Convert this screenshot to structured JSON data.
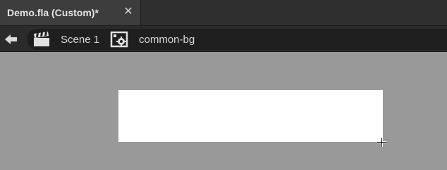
{
  "document_tab": {
    "title": "Demo.fla (Custom)*",
    "close_glyph": "✕",
    "close_icon": "close-icon"
  },
  "breadcrumb": {
    "back_icon": "arrow-left-icon",
    "items": [
      {
        "label": "Scene 1",
        "icon": "scene-clapperboard-icon"
      },
      {
        "label": "common-bg",
        "icon": "movieclip-symbol-icon"
      }
    ]
  },
  "stage": {
    "color": "#ffffff"
  },
  "colors": {
    "workspace_bg": "#999999",
    "tab_bg": "#3d3d3d",
    "toolbar_bg": "#2b2b2b",
    "breadcrumb_bg": "#1f1f1f",
    "text": "#d8d8d8"
  }
}
